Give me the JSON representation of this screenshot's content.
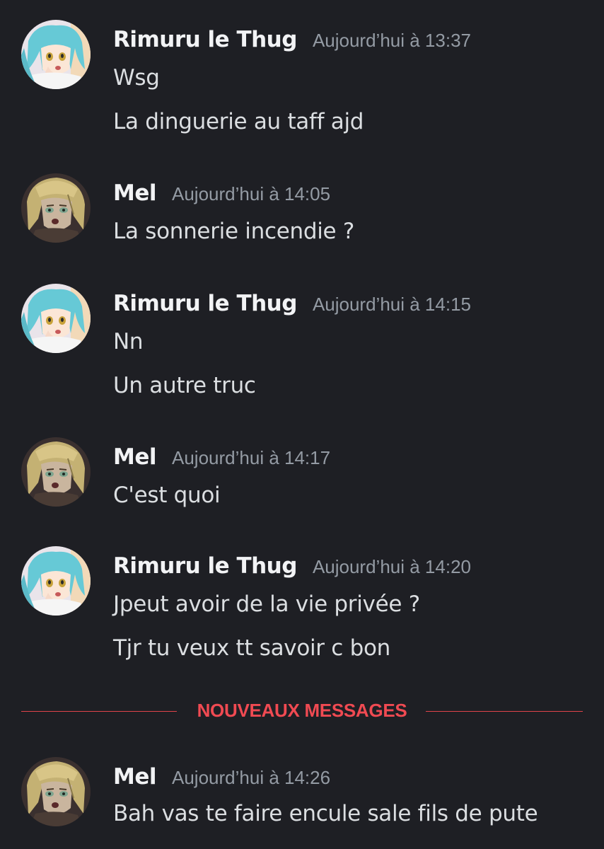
{
  "messages": [
    {
      "author": "Rimuru le Thug",
      "timestamp": "Aujourd’hui à 13:37",
      "lines": [
        "Wsg",
        "La dinguerie au taff ajd"
      ]
    },
    {
      "author": "Mel",
      "timestamp": "Aujourd’hui à 14:05",
      "lines": [
        "La sonnerie incendie ?"
      ]
    },
    {
      "author": "Rimuru le Thug",
      "timestamp": "Aujourd’hui à 14:15",
      "lines": [
        "Nn",
        "Un autre truc"
      ]
    },
    {
      "author": "Mel",
      "timestamp": "Aujourd’hui à 14:17",
      "lines": [
        "C'est quoi"
      ]
    },
    {
      "author": "Rimuru le Thug",
      "timestamp": "Aujourd’hui à 14:20",
      "lines": [
        "Jpeut avoir de la vie privée ?",
        "Tjr tu veux tt savoir c bon"
      ]
    },
    {
      "author": "Mel",
      "timestamp": "Aujourd’hui à 14:26",
      "lines": [
        "Bah vas te faire encule sale fils de pute"
      ]
    }
  ],
  "divider": {
    "label": "NOUVEAUX MESSAGES",
    "color": "#f04a52"
  },
  "avatars": {
    "rimuru": "rimuru-avatar",
    "mel": "mel-avatar"
  },
  "theme": {
    "background": "#1e1f24",
    "username_color": "#f2f3f5",
    "timestamp_color": "#949ba4",
    "text_color": "#dbdee1"
  }
}
